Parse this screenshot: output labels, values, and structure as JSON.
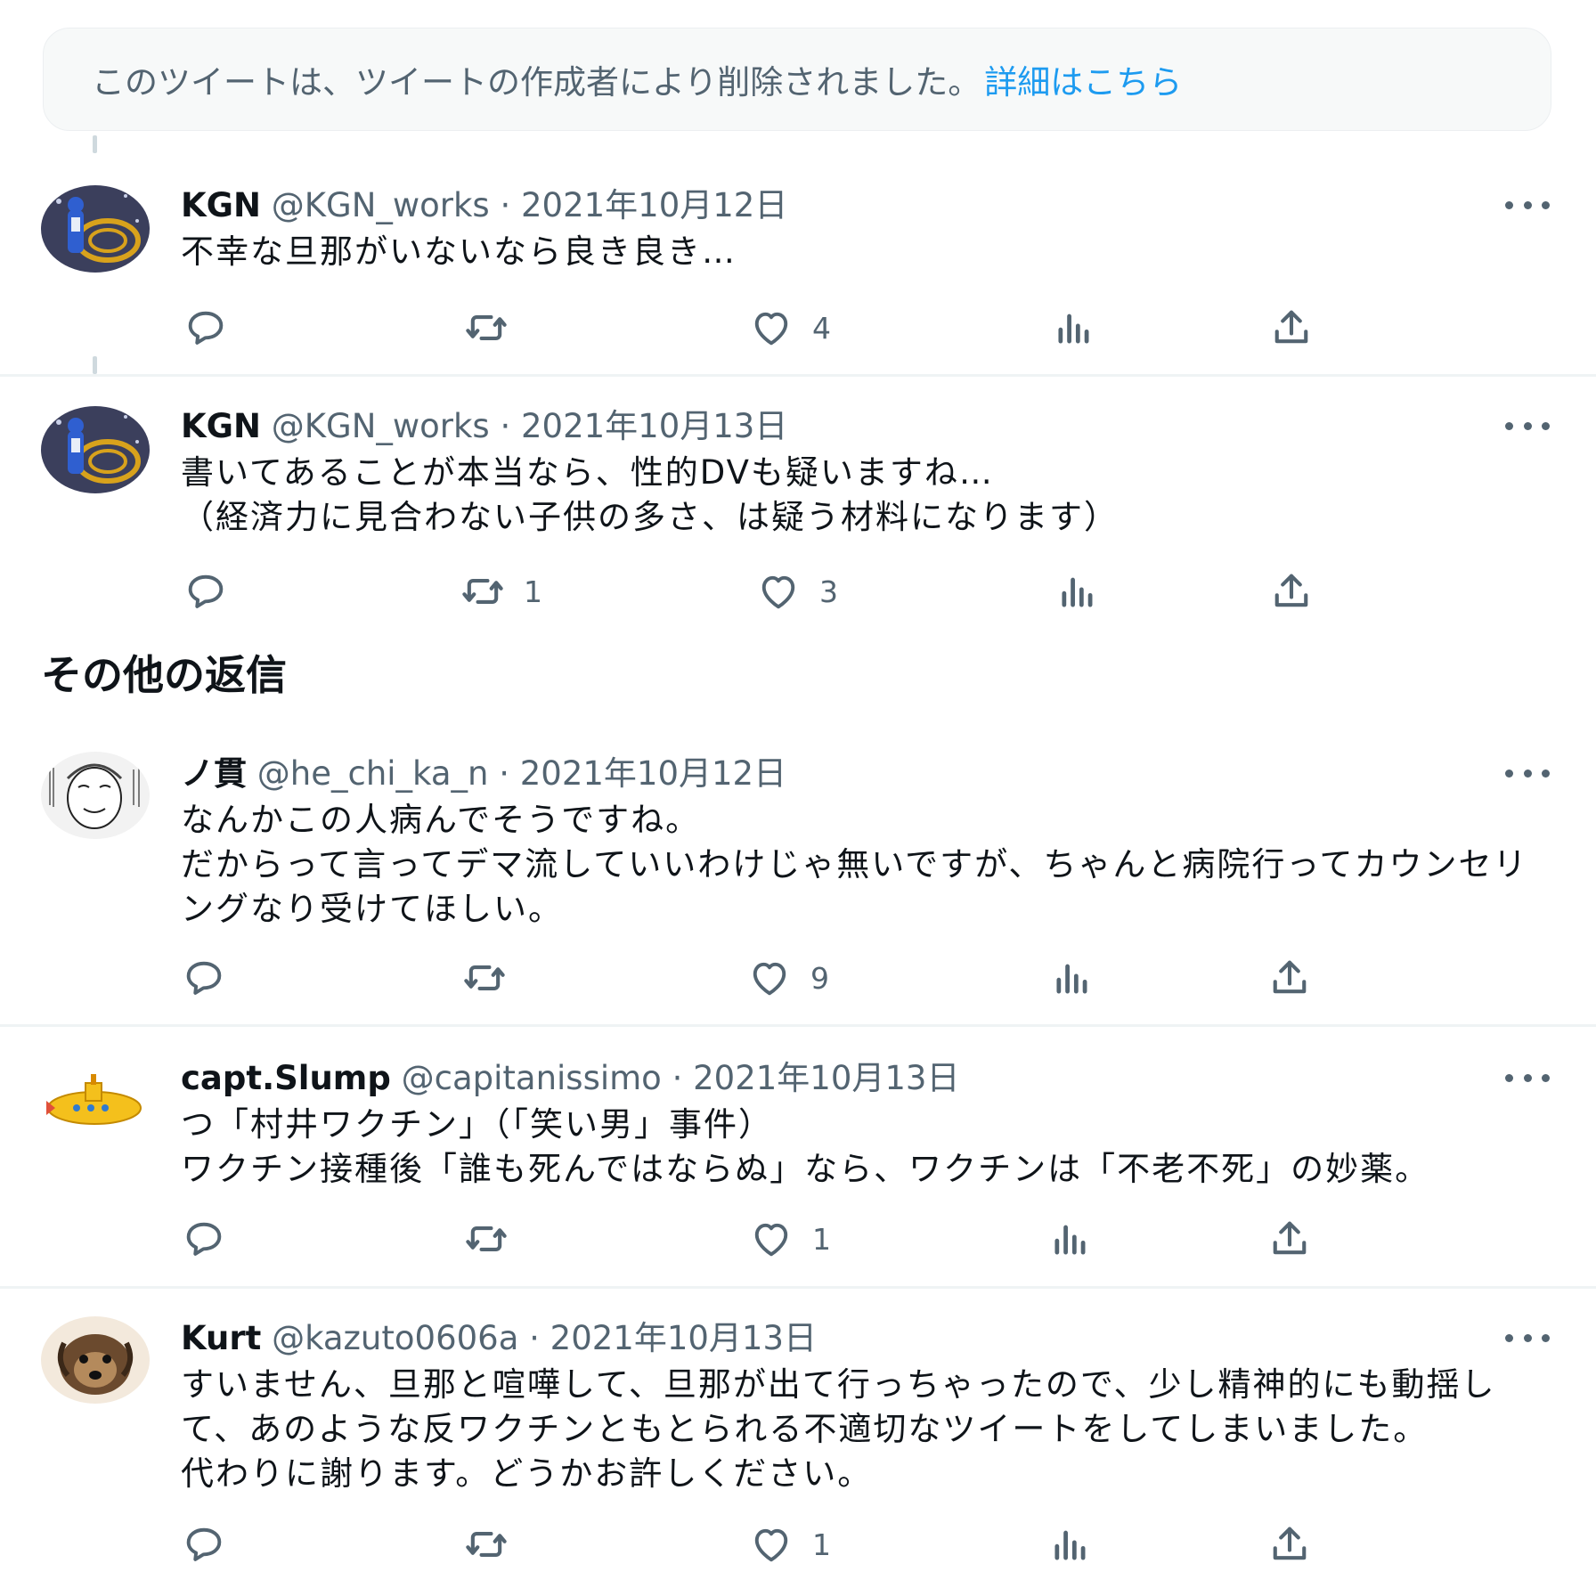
{
  "deleted_notice": {
    "text": "このツイートは、ツイートの作成者により削除されました。",
    "link": "詳細はこちら"
  },
  "section_title": "その他の返信",
  "tweets": [
    {
      "name": "KGN",
      "handle": "@KGN_works",
      "separator": "·",
      "date": "2021年10月12日",
      "text": "不幸な旦那がいないなら良き良き…",
      "retweets": "",
      "likes": "4",
      "avatar": "robot-figure-avatar"
    },
    {
      "name": "KGN",
      "handle": "@KGN_works",
      "separator": "·",
      "date": "2021年10月13日",
      "text": "書いてあることが本当なら、性的DVも疑いますね…\n（経済力に見合わない子供の多さ、は疑う材料になります）",
      "retweets": "1",
      "likes": "3",
      "avatar": "robot-figure-avatar"
    },
    {
      "name": "ノ貫",
      "handle": "@he_chi_ka_n",
      "separator": "·",
      "date": "2021年10月12日",
      "text": "なんかこの人病んでそうですね。\nだからって言ってデマ流していいわけじゃ無いですが、ちゃんと病院行ってカウンセリングなり受けてほしい。",
      "retweets": "",
      "likes": "9",
      "avatar": "manga-old-man-avatar"
    },
    {
      "name": "capt.Slump",
      "handle": "@capitanissimo",
      "separator": "·",
      "date": "2021年10月13日",
      "text": "つ「村井ワクチン」（「笑い男」事件）\nワクチン接種後「誰も死んではならぬ」なら、ワクチンは「不老不死」の妙薬。",
      "retweets": "",
      "likes": "1",
      "avatar": "yellow-submarine-avatar"
    },
    {
      "name": "Kurt",
      "handle": "@kazuto0606a",
      "separator": "·",
      "date": "2021年10月13日",
      "text": "すいません、旦那と喧嘩して、旦那が出て行っちゃったので、少し精神的にも動揺して、あのような反ワクチンともとられる不適切なツイートをしてしまいました。\n代わりに謝ります。どうかお許しください。",
      "retweets": "",
      "likes": "1",
      "avatar": "dog-avatar"
    }
  ],
  "colors": {
    "text": "#0f1419",
    "secondary": "#536471",
    "link": "#1d9bf0",
    "divider": "#eff3f4"
  },
  "icons": [
    "reply-icon",
    "retweet-icon",
    "like-icon",
    "views-icon",
    "share-icon",
    "more-icon"
  ]
}
